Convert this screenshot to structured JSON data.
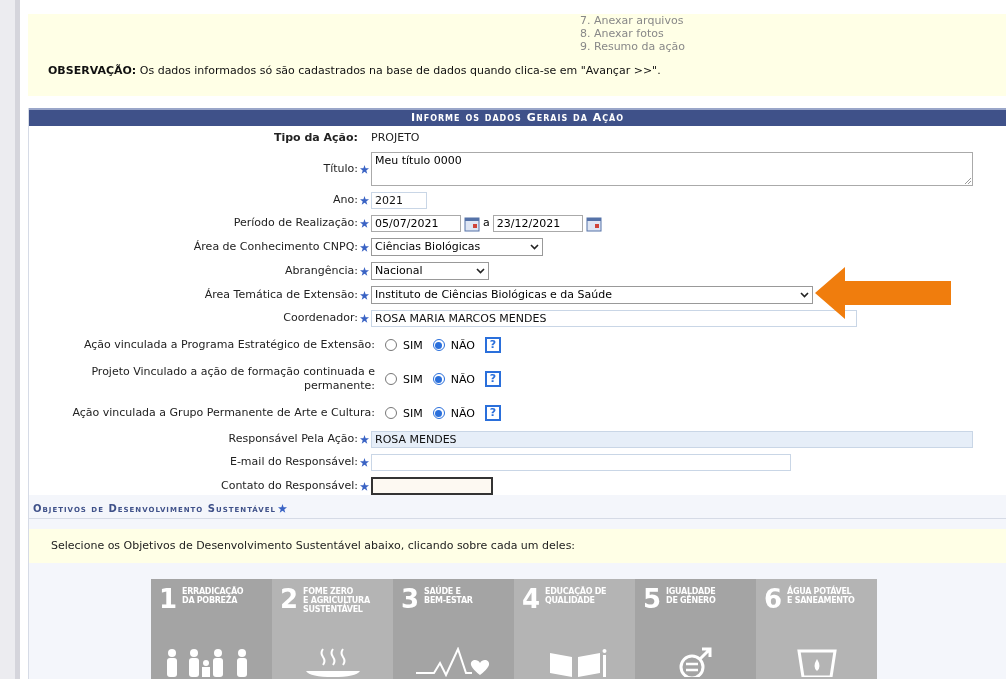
{
  "steps": [
    "7. Anexar arquivos",
    "8. Anexar fotos",
    "9. Resumo da ação"
  ],
  "note": {
    "label": "OBSERVAÇÃO:",
    "text": "Os dados informados só são cadastrados na base de dados quando clica-se em \"Avançar >>\"."
  },
  "section_title": "Informe os dados Gerais da Ação",
  "fields": [
    {
      "kind": "static",
      "label": "Tipo da Ação:",
      "required": false,
      "value": "PROJETO"
    },
    {
      "kind": "textarea",
      "label": "Título:",
      "required": true,
      "value": "Meu título 0000"
    },
    {
      "kind": "text",
      "label": "Ano:",
      "required": true,
      "value": "2021"
    },
    {
      "kind": "date_range",
      "label": "Período de Realização:",
      "required": true,
      "value": "05/07/2021",
      "separator": "a",
      "value_end": "23/12/2021"
    },
    {
      "kind": "select",
      "label": "Área de Conhecimento CNPQ:",
      "required": true,
      "value": "Ciências Biológicas"
    },
    {
      "kind": "select",
      "label": "Abrangência:",
      "required": true,
      "value": "Nacional"
    },
    {
      "kind": "select",
      "label": "Área Temática de Extensão:",
      "required": true,
      "value": "Instituto de Ciências Biológicas e da Saúde"
    },
    {
      "kind": "text",
      "label": "Coordenador:",
      "required": true,
      "value": "ROSA MARIA MARCOS MENDES"
    },
    {
      "kind": "radio",
      "label": "Ação vinculada a Programa Estratégico de Extensão:",
      "options": [
        {
          "label": "SIM",
          "selected": false
        },
        {
          "label": "NÃO",
          "selected": true
        }
      ],
      "help": "?"
    },
    {
      "kind": "radio",
      "label": "Projeto Vinculado a ação de formação continuada e permanente:",
      "options": [
        {
          "label": "SIM",
          "selected": false
        },
        {
          "label": "NÃO",
          "selected": true
        }
      ],
      "help": "?"
    },
    {
      "kind": "radio",
      "label": "Ação vinculada a Grupo Permanente de Arte e Cultura:",
      "options": [
        {
          "label": "SIM",
          "selected": false
        },
        {
          "label": "NÃO",
          "selected": true
        }
      ],
      "help": "?"
    },
    {
      "kind": "text",
      "label": "Responsável Pela Ação:",
      "required": true,
      "value": "ROSA MENDES",
      "readonly": true
    },
    {
      "kind": "text",
      "label": "E-mail do Responsável:",
      "required": true
    },
    {
      "kind": "text",
      "label": "Contato do Responsável:",
      "required": true,
      "focused": true
    }
  ],
  "ods": {
    "title": "Objetivos de Desenvolvimento Sustentável",
    "instruction": "Selecione os Objetivos de Desenvolvimento Sustentável abaixo, clicando sobre cada um deles:",
    "goals": [
      {
        "number": "1",
        "title": [
          "ERRADICAÇÃO",
          "DA POBREZA"
        ],
        "kind": "people"
      },
      {
        "number": "2",
        "title": [
          "FOME ZERO",
          "E AGRICULTURA",
          "SUSTENTÁVEL"
        ],
        "kind": "bowl"
      },
      {
        "number": "3",
        "title": [
          "SAÚDE E",
          "BEM-ESTAR"
        ],
        "kind": "heartbeat"
      },
      {
        "number": "4",
        "title": [
          "EDUCAÇÃO DE",
          "QUALIDADE"
        ],
        "kind": "book"
      },
      {
        "number": "5",
        "title": [
          "IGUALDADE",
          "DE GÊNERO"
        ],
        "kind": "gender"
      },
      {
        "number": "6",
        "title": [
          "ÁGUA POTÁVEL",
          "E SANEAMENTO"
        ],
        "kind": "glass"
      }
    ]
  }
}
